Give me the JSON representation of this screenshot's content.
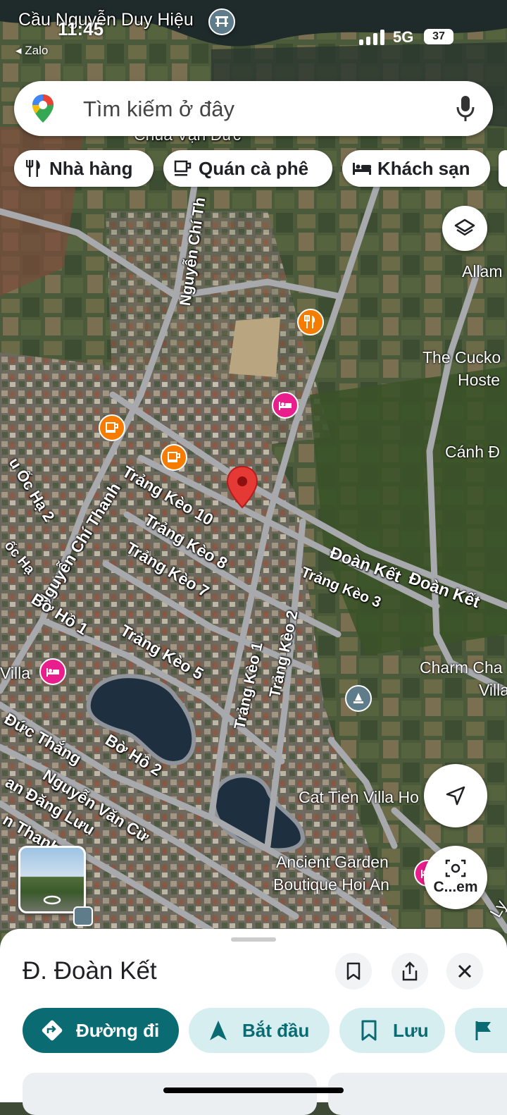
{
  "status_bar": {
    "time": "11:45",
    "back_app": "◂ Zalo",
    "network": "5G",
    "battery": "37"
  },
  "search": {
    "placeholder": "Tìm kiếm ở đây"
  },
  "chips": [
    {
      "label": "Nhà hàng",
      "icon": "fork-knife-icon"
    },
    {
      "label": "Quán cà phê",
      "icon": "coffee-cup-icon"
    },
    {
      "label": "Khách sạn",
      "icon": "bed-icon"
    }
  ],
  "map": {
    "street_labels": {
      "nguyen_chi_thanh_top": "Nguyễn Chí Th",
      "trang_keo_10": "Trảng Kèo 10",
      "trang_keo_8": "Trảng Kèo 8",
      "trang_keo_7": "Trảng Kèo 7",
      "trang_keo_5": "Trảng Kèo 5",
      "trang_keo_1": "Trảng Kèo 1",
      "trang_keo_2": "Trảng Kèo 2",
      "trang_keo_3": "Trảng Kèo 3",
      "doan_ket_1": "Đoàn Kết",
      "doan_ket_2": "Đoàn Kết",
      "nguyen_chi_thanh": "Nguyễn Chí Thanh",
      "bo_ho_1": "Bờ Hồ 1",
      "bo_ho_2": "Bờ Hồ 2",
      "duc_thang": "Đức Thắng",
      "nguyen_van_cu": "Nguyễn Văn Cừ",
      "dang_luu": "an Đăng Lưu",
      "thanh": "n Thanh",
      "oc_ha_2": "u Ốc Hạ 2",
      "oc_ha": "ốc Hạ",
      "chua": "Chùa Vạn Đức",
      "bridge": "Cầu Nguyễn Duy Hiệu"
    },
    "place_labels": {
      "allam": "Allam",
      "cuckoo_1": "The Cucko",
      "cuckoo_2": "Hoste",
      "canh": "Cánh Đ",
      "charm_1": "Charm Cha",
      "charm_2": "Villa",
      "villa_left": "Villa",
      "cat_tien": "Cat Tien Villa Ho",
      "ancient_1": "Ancient Garden",
      "ancient_2": "Boutique Hoi An",
      "right_edge": "Ly"
    },
    "poi_colors": {
      "restaurant": "#f57c00",
      "cafe": "#f57c00",
      "hotel": "#e91e8c",
      "landmark": "#5f7c8a"
    },
    "camera_label": "C...em"
  },
  "sheet": {
    "title": "Đ. Đoàn Kết",
    "actions": [
      {
        "label": "Đường đi",
        "icon": "directions-icon"
      },
      {
        "label": "Bắt đầu",
        "icon": "navigation-arrow-icon"
      },
      {
        "label": "Lưu",
        "icon": "bookmark-icon"
      }
    ]
  },
  "colors": {
    "accent": "#0b6b73",
    "accent_light": "#d7eef0",
    "pin": "#e53935"
  }
}
